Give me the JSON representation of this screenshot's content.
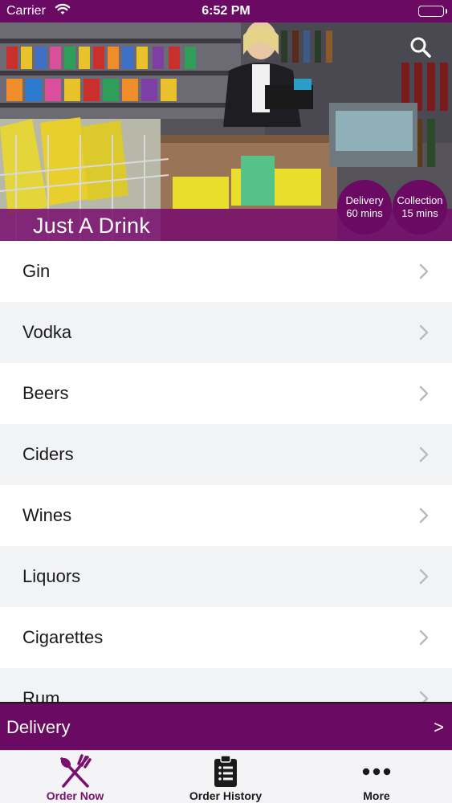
{
  "status_bar": {
    "carrier": "Carrier",
    "time": "6:52 PM"
  },
  "header": {
    "store_name": "Just A Drink",
    "delivery_badge": {
      "line1": "Delivery",
      "line2": "60 mins"
    },
    "collection_badge": {
      "line1": "Collection",
      "line2": "15 mins"
    },
    "search_icon": "search-icon"
  },
  "categories": [
    {
      "label": "Gin"
    },
    {
      "label": "Vodka"
    },
    {
      "label": "Beers"
    },
    {
      "label": "Ciders"
    },
    {
      "label": "Wines"
    },
    {
      "label": "Liquors"
    },
    {
      "label": "Cigarettes"
    },
    {
      "label": "Rum"
    }
  ],
  "delivery_bar": {
    "label": "Delivery",
    "arrow": ">"
  },
  "tab_bar": {
    "tabs": [
      {
        "label": "Order Now",
        "icon": "fork-knife-icon",
        "active": true
      },
      {
        "label": "Order History",
        "icon": "clipboard-list-icon",
        "active": false
      },
      {
        "label": "More",
        "icon": "more-dots-icon",
        "active": false
      }
    ]
  },
  "colors": {
    "brand": "#6b0a63",
    "active_tab": "#7a1170"
  }
}
